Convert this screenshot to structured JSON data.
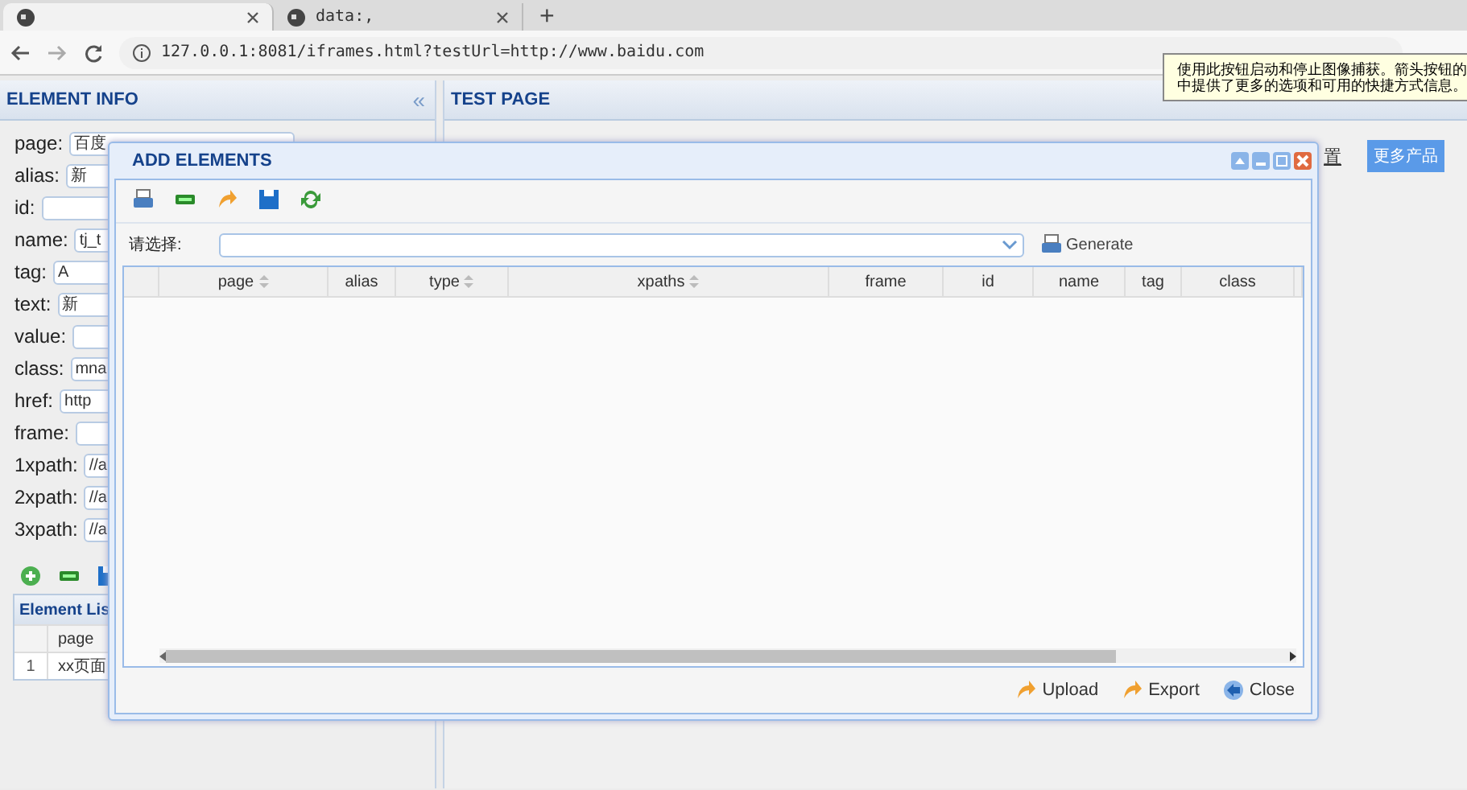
{
  "browser": {
    "tabs": [
      {
        "selected": true
      },
      {
        "title": "data:,",
        "selected": false
      }
    ],
    "new_tab": "+",
    "address": "127.0.0.1:8081/iframes.html?testUrl=http://www.baidu.com"
  },
  "tooltip": {
    "lines": [
      "使用此按钮启动和停止图像捕获。箭头按钮的",
      "中提供了更多的选项和可用的快捷方式信息。"
    ]
  },
  "element_info": {
    "title": "ELEMENT INFO",
    "collapse": "«",
    "fields": [
      {
        "label": "page:",
        "value": "百度"
      },
      {
        "label": "alias:",
        "value": "新"
      },
      {
        "label": "id:"
      },
      {
        "label": "name:",
        "value": "tj_t"
      },
      {
        "label": "tag:",
        "value": "A"
      },
      {
        "label": "text:",
        "value": "新"
      },
      {
        "label": "value:"
      },
      {
        "label": "class:",
        "value": "mna"
      },
      {
        "label": "href:",
        "value": "http"
      },
      {
        "label": "frame:"
      },
      {
        "label": "1xpath:",
        "value": "//a"
      },
      {
        "label": "2xpath:",
        "value": "//a"
      },
      {
        "label": "3xpath:",
        "value": "//a"
      }
    ],
    "element_list": {
      "title": "Element Lis",
      "columns": [
        "page"
      ],
      "rows": [
        {
          "number": "1",
          "page": "xx页面"
        }
      ]
    }
  },
  "test_page": {
    "title": "TEST PAGE",
    "link": "置",
    "button": "更多产品"
  },
  "dialog": {
    "title": "ADD ELEMENTS",
    "select_label": "请选择:",
    "generate": "Generate",
    "columns": [
      {
        "sortable": false
      },
      {
        "label": "page",
        "sortable": true
      },
      {
        "label": "alias",
        "sortable": false
      },
      {
        "label": "type",
        "sortable": true
      },
      {
        "label": "xpaths",
        "sortable": true
      },
      {
        "label": "frame",
        "sortable": false
      },
      {
        "label": "id",
        "sortable": false
      },
      {
        "label": "name",
        "sortable": false
      },
      {
        "label": "tag",
        "sortable": false
      },
      {
        "label": "class",
        "sortable": false
      }
    ],
    "footer": [
      {
        "label": "Upload",
        "kind": "upload"
      },
      {
        "label": "Export",
        "kind": "export"
      },
      {
        "label": "Close",
        "kind": "close"
      }
    ]
  }
}
